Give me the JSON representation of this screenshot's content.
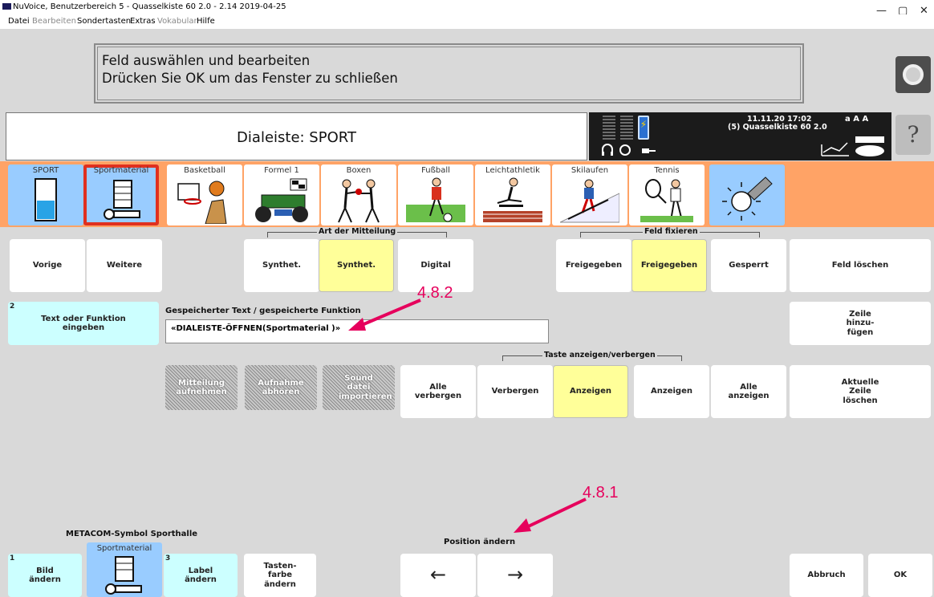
{
  "window": {
    "title": "NuVoice, Benutzerbereich 5 - Quasselkiste 60 2.0 - 2.14 2019-04-25",
    "controls": [
      "—",
      "▢",
      "✕"
    ]
  },
  "menu": [
    {
      "label": "Datei",
      "enabled": true
    },
    {
      "label": "Bearbeiten",
      "enabled": false
    },
    {
      "label": "Sondertasten",
      "enabled": true
    },
    {
      "label": "Extras",
      "enabled": true
    },
    {
      "label": "Vokabular",
      "enabled": false
    },
    {
      "label": "Hilfe",
      "enabled": true
    }
  ],
  "message": {
    "line1": "Feld auswählen und bearbeiten",
    "line2": "Drücken Sie OK um das Fenster zu schließen"
  },
  "header": {
    "title": "Dialeiste: SPORT",
    "help": "?"
  },
  "status": {
    "datetime": "11.11.20 17:02",
    "device": "(5) Quasselkiste 60 2.0",
    "font_indicator": "a A A"
  },
  "dialeiste": {
    "tiles": [
      {
        "label": "SPORT",
        "icon": "battery-level-icon",
        "color": "#99ccff"
      },
      {
        "label": "Sportmaterial",
        "icon": "sports-hall-icon",
        "color": "#99ccff",
        "selected": true
      },
      {
        "label": "Basketball",
        "icon": "basketball-icon",
        "color": "#ffffff"
      },
      {
        "label": "Formel 1",
        "icon": "racing-car-icon",
        "color": "#ffffff"
      },
      {
        "label": "Boxen",
        "icon": "boxing-icon",
        "color": "#ffffff"
      },
      {
        "label": "Fußball",
        "icon": "soccer-icon",
        "color": "#ffffff"
      },
      {
        "label": "Leichtathletik",
        "icon": "hurdles-icon",
        "color": "#ffffff"
      },
      {
        "label": "Skilaufen",
        "icon": "skiing-icon",
        "color": "#ffffff"
      },
      {
        "label": "Tennis",
        "icon": "tennis-icon",
        "color": "#ffffff"
      },
      {
        "label": "",
        "icon": "eraser-sun-icon",
        "color": "#99ccff"
      }
    ]
  },
  "row1": {
    "prev": "Vorige",
    "next": "Weitere",
    "group_label": "Art der Mitteilung",
    "synth1": "Synthet.",
    "synth2": "Synthet.",
    "digital": "Digital",
    "fix_group_label": "Feld fixieren",
    "free1": "Freigegeben",
    "free2": "Freigegeben",
    "locked": "Gesperrt",
    "delete_field": "Feld löschen"
  },
  "row2": {
    "number": "2",
    "text_fn": "Text oder Funktion eingeben",
    "stored_label": "Gespeicherter Text / gespeicherte Funktion",
    "stored_value": "«DIALEISTE-ÖFFNEN(Sportmaterial )»",
    "add_row": "Zeile hinzu- fügen",
    "annotation": "4.8.2"
  },
  "row3": {
    "group_label": "Taste anzeigen/verbergen",
    "record": "Mitteilung aufnehmen",
    "play": "Aufnahme abhören",
    "import": "Sound datei importieren",
    "hide_all": "Alle verbergen",
    "hide": "Verbergen",
    "show_sel": "Anzeigen",
    "show": "Anzeigen",
    "show_all": "Alle anzeigen",
    "delete_row": "Aktuelle Zeile löschen"
  },
  "bottom": {
    "symbol_label": "METACOM-Symbol Sporthalle",
    "pos_label": "Position ändern",
    "annotation": "4.8.1",
    "n1": "1",
    "change_image": "Bild ändern",
    "preview_label": "Sportmaterial",
    "n3": "3",
    "change_label": "Label ändern",
    "key_color": "Tasten- farbe ändern",
    "left_arrow": "←",
    "right_arrow": "→",
    "cancel": "Abbruch",
    "ok": "OK"
  }
}
